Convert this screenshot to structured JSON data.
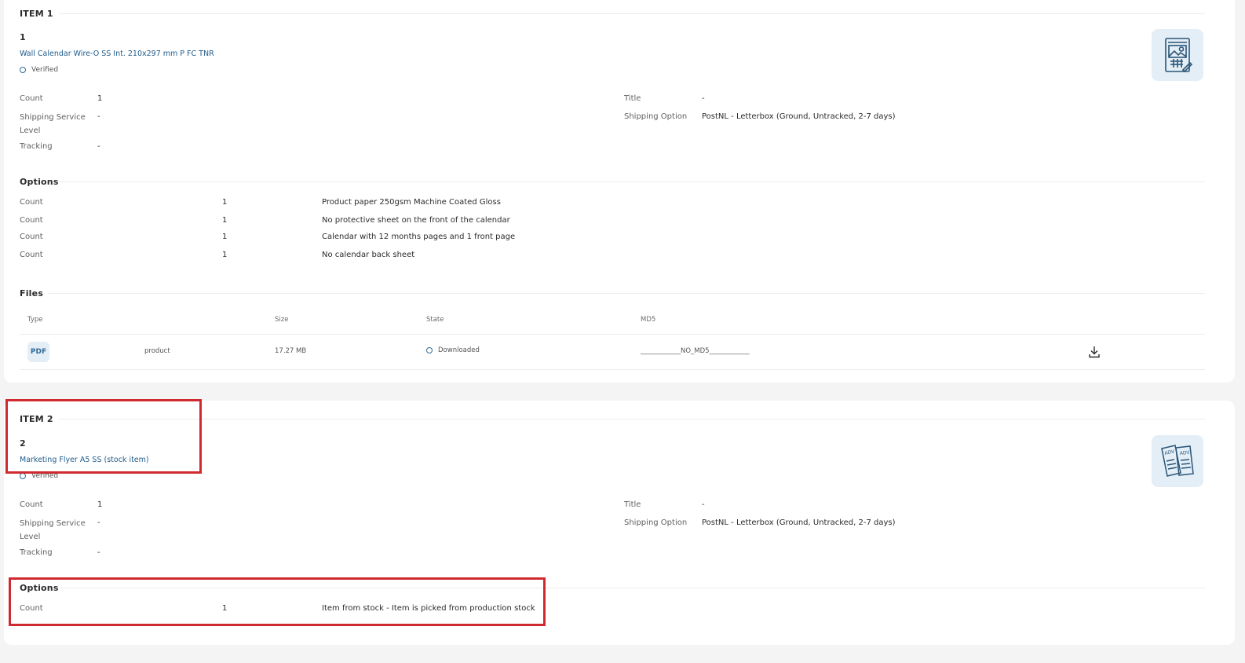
{
  "items": [
    {
      "heading": "ITEM 1",
      "number": "1",
      "product_name": "Wall Calendar Wire-O SS Int. 210x297 mm P FC TNR",
      "status": "Verified",
      "thumbnail_icon": "calendar-document-icon",
      "details": {
        "count_label": "Count",
        "count_value": "1",
        "shipping_service_label": "Shipping Service\nLevel",
        "shipping_service_value": "-",
        "tracking_label": "Tracking",
        "tracking_value": "-",
        "title_label": "Title",
        "title_value": "-",
        "shipping_option_label": "Shipping Option",
        "shipping_option_value": "PostNL - Letterbox (Ground, Untracked, 2-7 days)"
      },
      "options_heading": "Options",
      "options": [
        {
          "label": "Count",
          "count": "1",
          "description": "Product paper 250gsm Machine Coated Gloss"
        },
        {
          "label": "Count",
          "count": "1",
          "description": "No protective sheet on the front of the calendar"
        },
        {
          "label": "Count",
          "count": "1",
          "description": "Calendar with 12 months pages and 1 front page"
        },
        {
          "label": "Count",
          "count": "1",
          "description": "No calendar back sheet"
        }
      ],
      "files_heading": "Files",
      "files_columns": [
        "Type",
        "Size",
        "State",
        "MD5"
      ],
      "files": [
        {
          "type_badge": "PDF",
          "type": "product",
          "size": "17.27 MB",
          "state": "Downloaded",
          "md5": "____________NO_MD5____________",
          "action_icon": "download-icon"
        }
      ]
    },
    {
      "heading": "ITEM 2",
      "number": "2",
      "product_name": "Marketing Flyer A5 SS (stock item)",
      "status": "Verified",
      "thumbnail_icon": "flyer-adv-icon",
      "details": {
        "count_label": "Count",
        "count_value": "1",
        "shipping_service_label": "Shipping Service\nLevel",
        "shipping_service_value": "-",
        "tracking_label": "Tracking",
        "tracking_value": "-",
        "title_label": "Title",
        "title_value": "-",
        "shipping_option_label": "Shipping Option",
        "shipping_option_value": "PostNL - Letterbox (Ground, Untracked, 2-7 days)"
      },
      "options_heading": "Options",
      "options": [
        {
          "label": "Count",
          "count": "1",
          "description": "Item from stock - Item is picked from production stock"
        }
      ]
    }
  ],
  "colors": {
    "link": "#1f5b8a",
    "accent_bg": "#e4eef6",
    "highlight": "#cf2a2f"
  }
}
